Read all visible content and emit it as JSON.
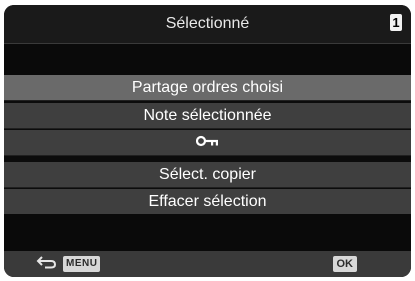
{
  "header": {
    "title": "Sélectionné",
    "page_number": "1"
  },
  "menu": {
    "items": [
      {
        "label": "Partage ordres choisi",
        "selected": true
      },
      {
        "label": "Note sélectionnée",
        "selected": false
      },
      {
        "label": "",
        "icon": "key-protect-icon",
        "selected": false
      },
      {
        "label": "Sélect. copier",
        "selected": false
      },
      {
        "label": "Effacer sélection",
        "selected": false
      }
    ]
  },
  "footer": {
    "back_icon": "return-arrow-icon",
    "menu_label": "MENU",
    "ok_label": "OK"
  },
  "colors": {
    "background": "#0c0c0c",
    "item": "#3f3f3f",
    "item_selected": "#6a6a6a",
    "text": "#ffffff"
  }
}
